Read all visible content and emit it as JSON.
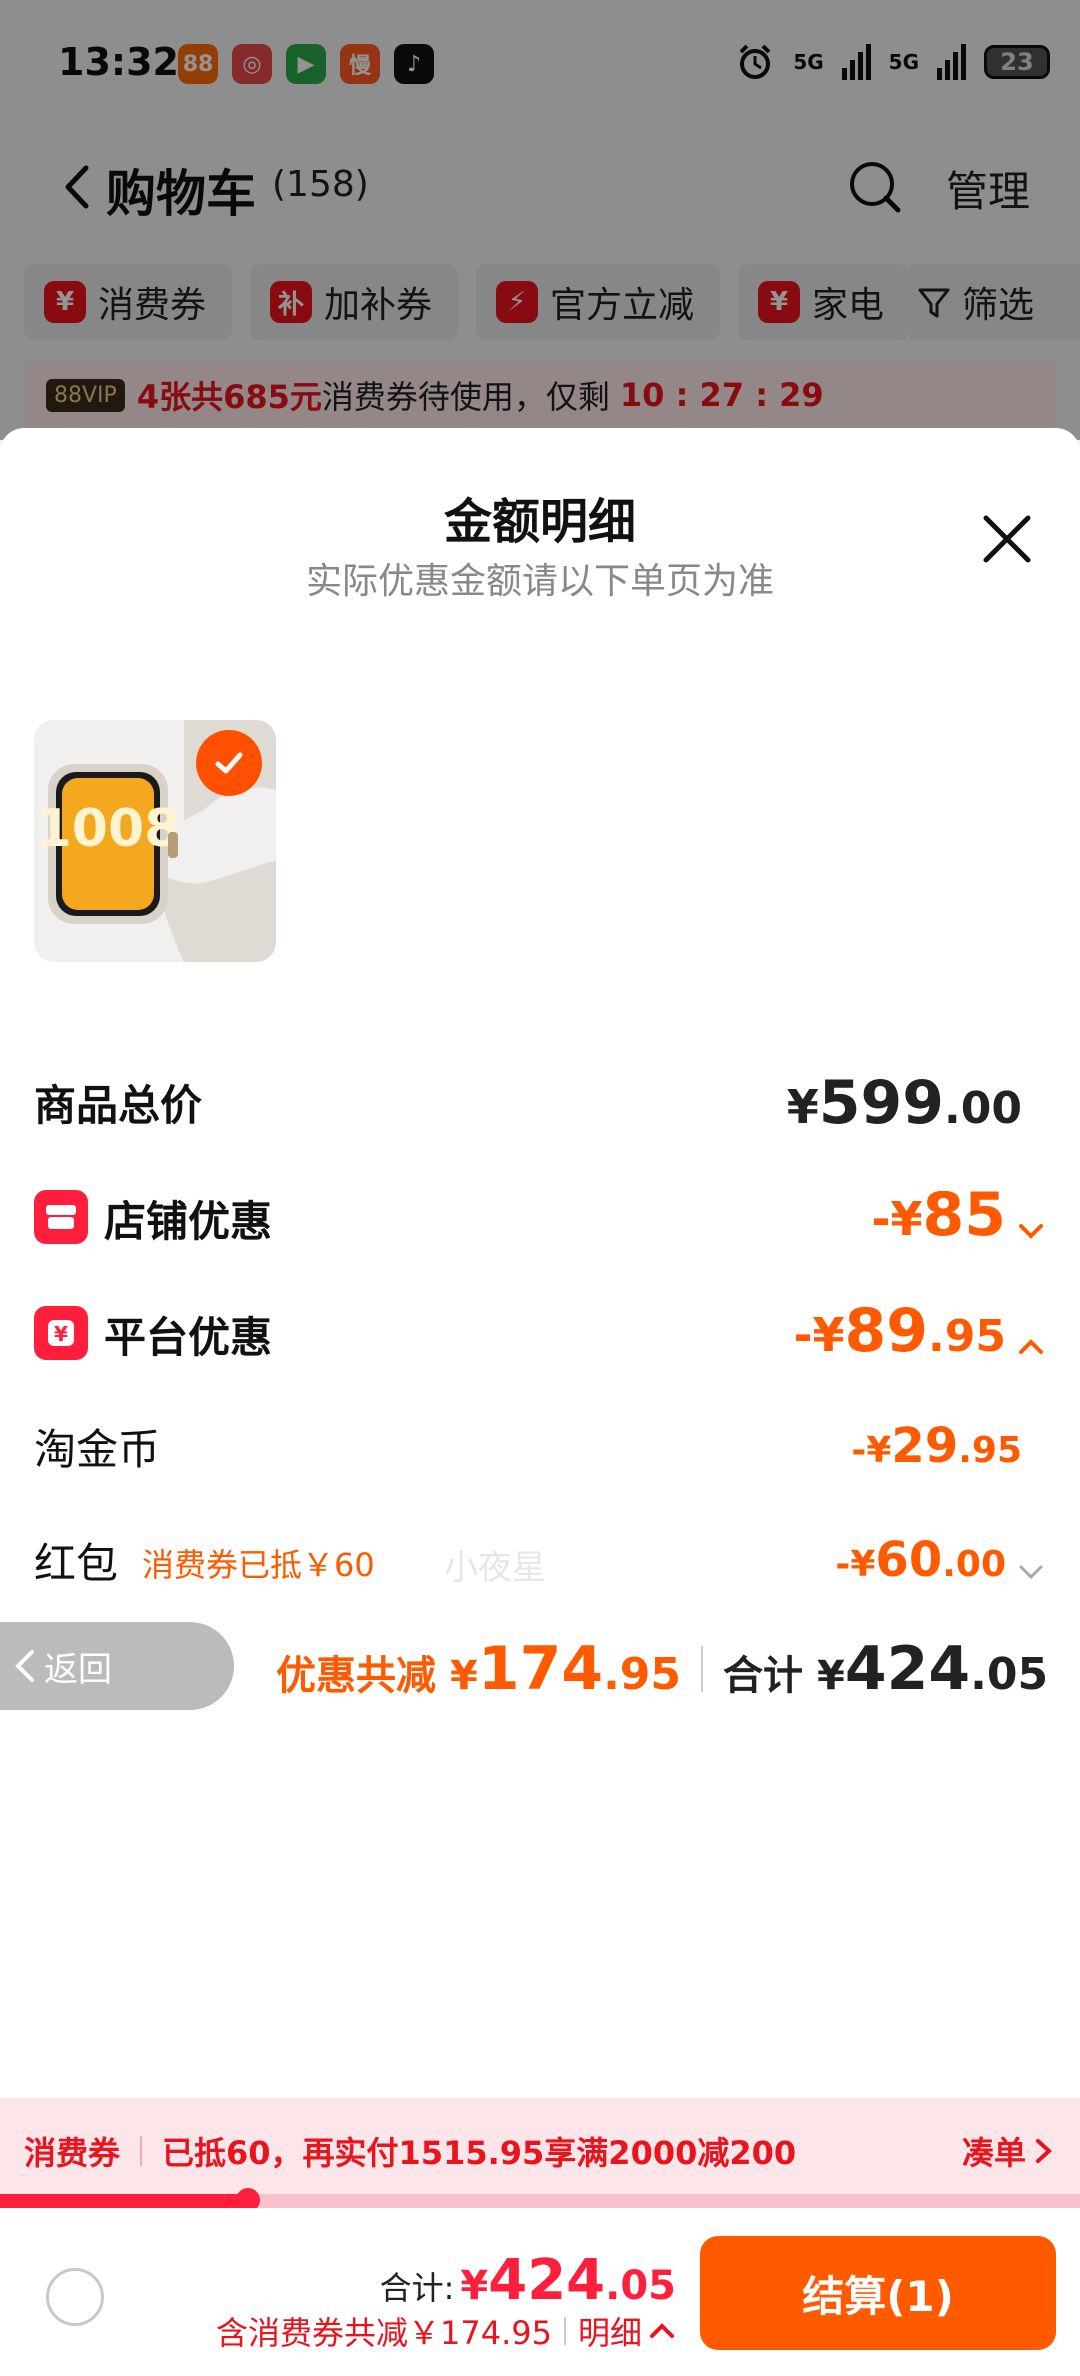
{
  "status_bar": {
    "time": "13:32",
    "apps": [
      {
        "name": "app-88vip-icon",
        "glyph": "88",
        "color": "#ff6a00"
      },
      {
        "name": "app-game-icon",
        "glyph": "◎",
        "color": "#e64a4a"
      },
      {
        "name": "app-video-icon",
        "glyph": "▶",
        "color": "#2aa84a"
      },
      {
        "name": "app-man-icon",
        "glyph": "慢",
        "color": "#ff5a1f"
      },
      {
        "name": "app-tiktok-icon",
        "glyph": "♪",
        "color": "#111111"
      }
    ],
    "net1": "5G",
    "net2": "5G",
    "battery": "23"
  },
  "nav": {
    "title": "购物车",
    "count": "(158)",
    "manage": "管理"
  },
  "chips": [
    {
      "icon": "¥",
      "label": "消费券"
    },
    {
      "icon": "补",
      "label": "加补券"
    },
    {
      "icon": "⚡",
      "label": "官方立减"
    },
    {
      "icon": "¥",
      "label": "家电"
    }
  ],
  "filter_label": "筛选",
  "voucher_strip": {
    "badge": "88VIP",
    "highlight": "4张共685元",
    "text": "消费券待使用，仅剩",
    "countdown": "10 : 27 : 29"
  },
  "sheet": {
    "title": "金额明细",
    "subtitle": "实际优惠金额请以下单页为准",
    "watermark": "小夜星",
    "product_digits": "1008",
    "rows": {
      "total": {
        "label": "商品总价",
        "yen": "¥",
        "int": "599",
        "dec": ".00"
      },
      "shop": {
        "label": "店铺优惠",
        "prefix": "-¥",
        "int": "85",
        "dec": ""
      },
      "platform": {
        "label": "平台优惠",
        "prefix": "-¥",
        "int": "89",
        "dec": ".95"
      },
      "coin": {
        "label": "淘金币",
        "prefix": "-¥",
        "int": "29",
        "dec": ".95"
      },
      "redpack": {
        "label": "红包",
        "note": "消费券已抵￥60",
        "prefix": "-¥",
        "int": "60",
        "dec": ".00"
      }
    },
    "back_label": "返回",
    "summary": {
      "saved_label": "优惠共减",
      "saved_yen": "¥",
      "saved_int": "174",
      "saved_dec": ".95",
      "total_label": "合计",
      "total_yen": "¥",
      "total_int": "424",
      "total_dec": ".05"
    }
  },
  "coupon_bar": {
    "label": "消费券",
    "message": "已抵60，再实付1515.95享满2000减200",
    "cta": "凑单",
    "progress": 0.23
  },
  "checkout": {
    "total_label": "合计:",
    "total_yen": "¥",
    "total_int": "424",
    "total_dec": ".05",
    "discount_text": "含消费券共减￥174.95",
    "detail_label": "明细",
    "button_label": "结算(1)"
  },
  "colors": {
    "accent_orange": "#ff5a00",
    "accent_red": "#ff1f3d"
  }
}
